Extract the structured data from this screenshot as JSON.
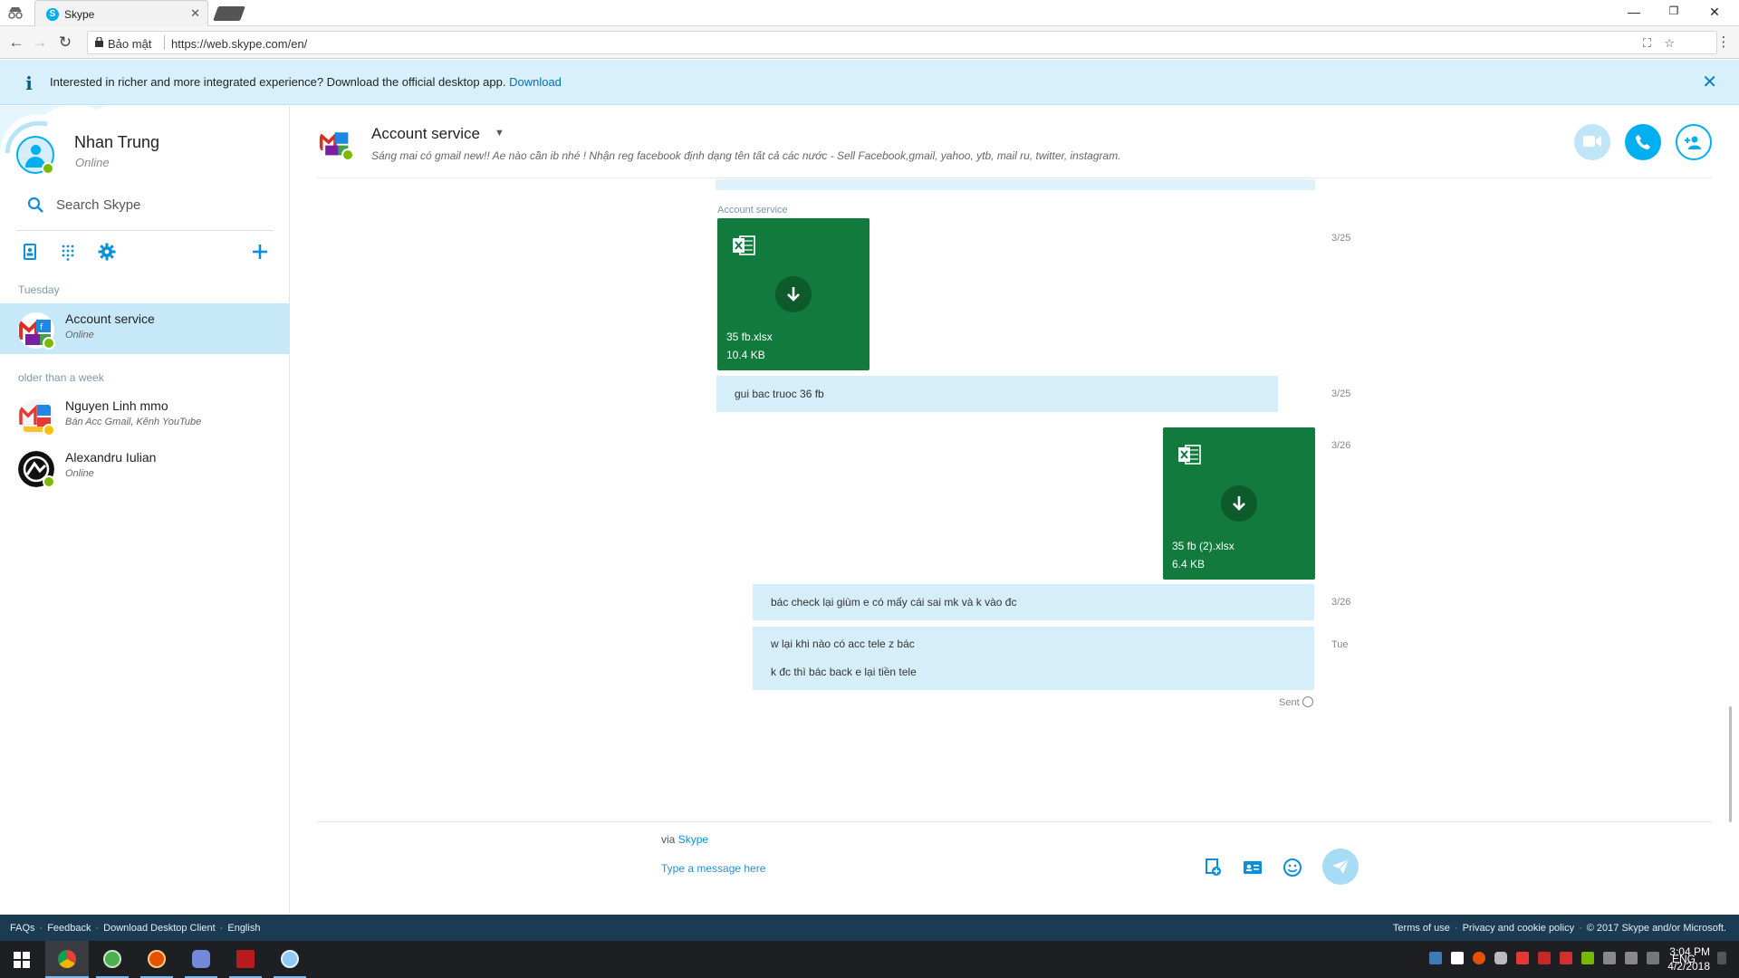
{
  "browser": {
    "tab_title": "Skype",
    "tab_favicon": "S",
    "secure_label": "Bảo mật",
    "url": "https://web.skype.com/en/"
  },
  "banner": {
    "message": "Interested in richer and more integrated experience? Download the official desktop app.",
    "link": "Download"
  },
  "me": {
    "name": "Nhan Trung",
    "status": "Online"
  },
  "search": {
    "placeholder": "Search Skype"
  },
  "sections": {
    "recent": "Tuesday",
    "older": "older than a week"
  },
  "contacts": [
    {
      "name": "Account service",
      "sub": "Online",
      "presence": "online"
    },
    {
      "name": "Nguyen Linh mmo",
      "sub": "Bán Acc Gmail, Kênh YouTube",
      "presence": "away"
    },
    {
      "name": "Alexandru Iulian",
      "sub": "Online",
      "presence": "online"
    }
  ],
  "conversation": {
    "title": "Account service",
    "mood": "Sáng mai có gmail new!! Ae nào cần ib nhé ! Nhận reg facebook định dạng tên tất cả các nước - Sell Facebook,gmail, yahoo, ytb, mail ru, twitter, instagram.",
    "sender_label": "Account service",
    "files": [
      {
        "name": "35 fb.xlsx",
        "size": "10.4 KB",
        "time": "3/25"
      },
      {
        "name": "35 fb (2).xlsx",
        "size": "6.4 KB",
        "time": "3/26"
      }
    ],
    "messages": [
      {
        "lines": [
          "gui bac truoc 36 fb"
        ],
        "time": "3/25"
      },
      {
        "lines": [
          "bác check lại giùm e có mấy cái sai mk và k vào đc"
        ],
        "time": "3/26"
      },
      {
        "lines": [
          "w lại khi nào có acc tele z bác",
          "k đc thì bác back e lại tiền tele"
        ],
        "time": "Tue"
      }
    ],
    "sent_status": "Sent"
  },
  "composer": {
    "via_prefix": "via",
    "via_link": "Skype",
    "placeholder": "Type a message here"
  },
  "footer": {
    "left": [
      "FAQs",
      "Feedback",
      "Download Desktop Client",
      "English"
    ],
    "right": [
      "Terms of use",
      "Privacy and cookie policy",
      "© 2017 Skype and/or Microsoft."
    ]
  },
  "taskbar": {
    "lang": "ENG",
    "time": "3:04 PM",
    "date": "4/2/2018"
  },
  "colors": {
    "skype_blue": "#00aff0",
    "excel_green": "#127a3d",
    "bubble": "#d5eef9",
    "selected_contact": "#c6e8f8",
    "footer": "#1b3b52",
    "online": "#7cb900",
    "away": "#ffc000"
  }
}
